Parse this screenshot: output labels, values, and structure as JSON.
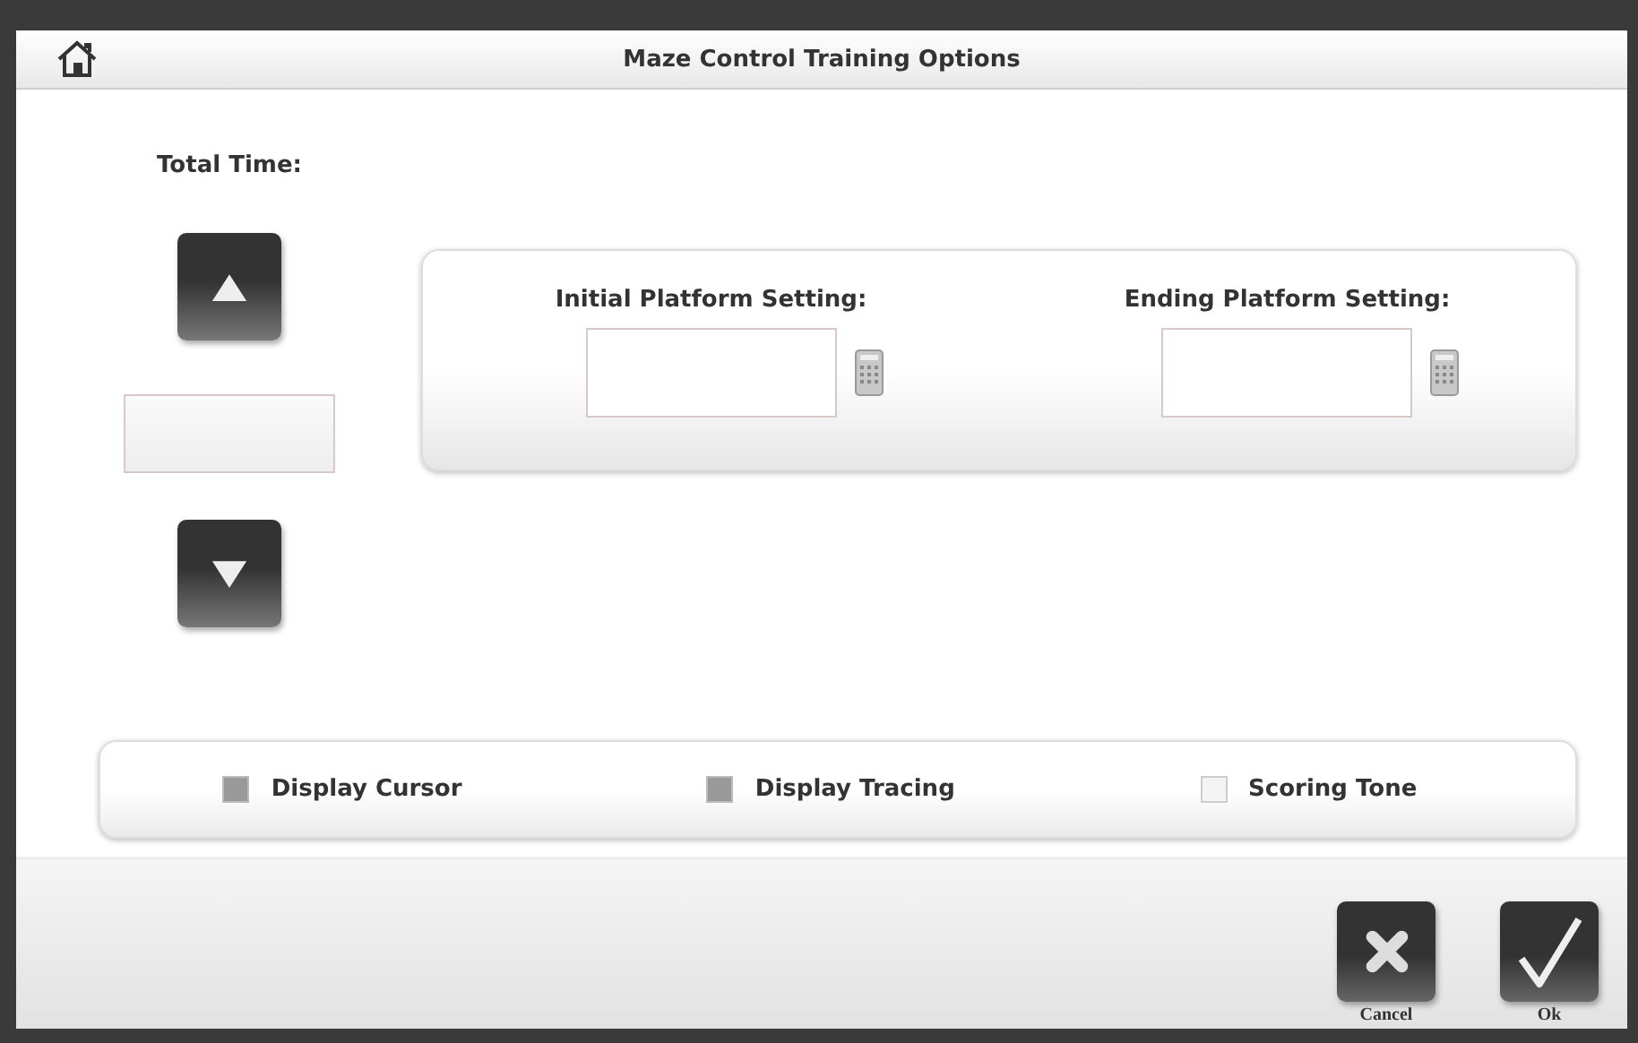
{
  "window": {
    "title": "Maze Control Training Options"
  },
  "total_time": {
    "label": "Total Time:"
  },
  "platform_settings": [
    {
      "label": "Initial Platform Setting:"
    },
    {
      "label": "Ending Platform Setting:"
    }
  ],
  "options": [
    {
      "label": "Display Cursor",
      "checked": true
    },
    {
      "label": "Display Tracing",
      "checked": true
    },
    {
      "label": "Scoring Tone",
      "checked": false
    }
  ],
  "buttons": [
    {
      "kind": "cancel",
      "label": "Cancel"
    },
    {
      "kind": "ok",
      "label": "Ok"
    }
  ]
}
